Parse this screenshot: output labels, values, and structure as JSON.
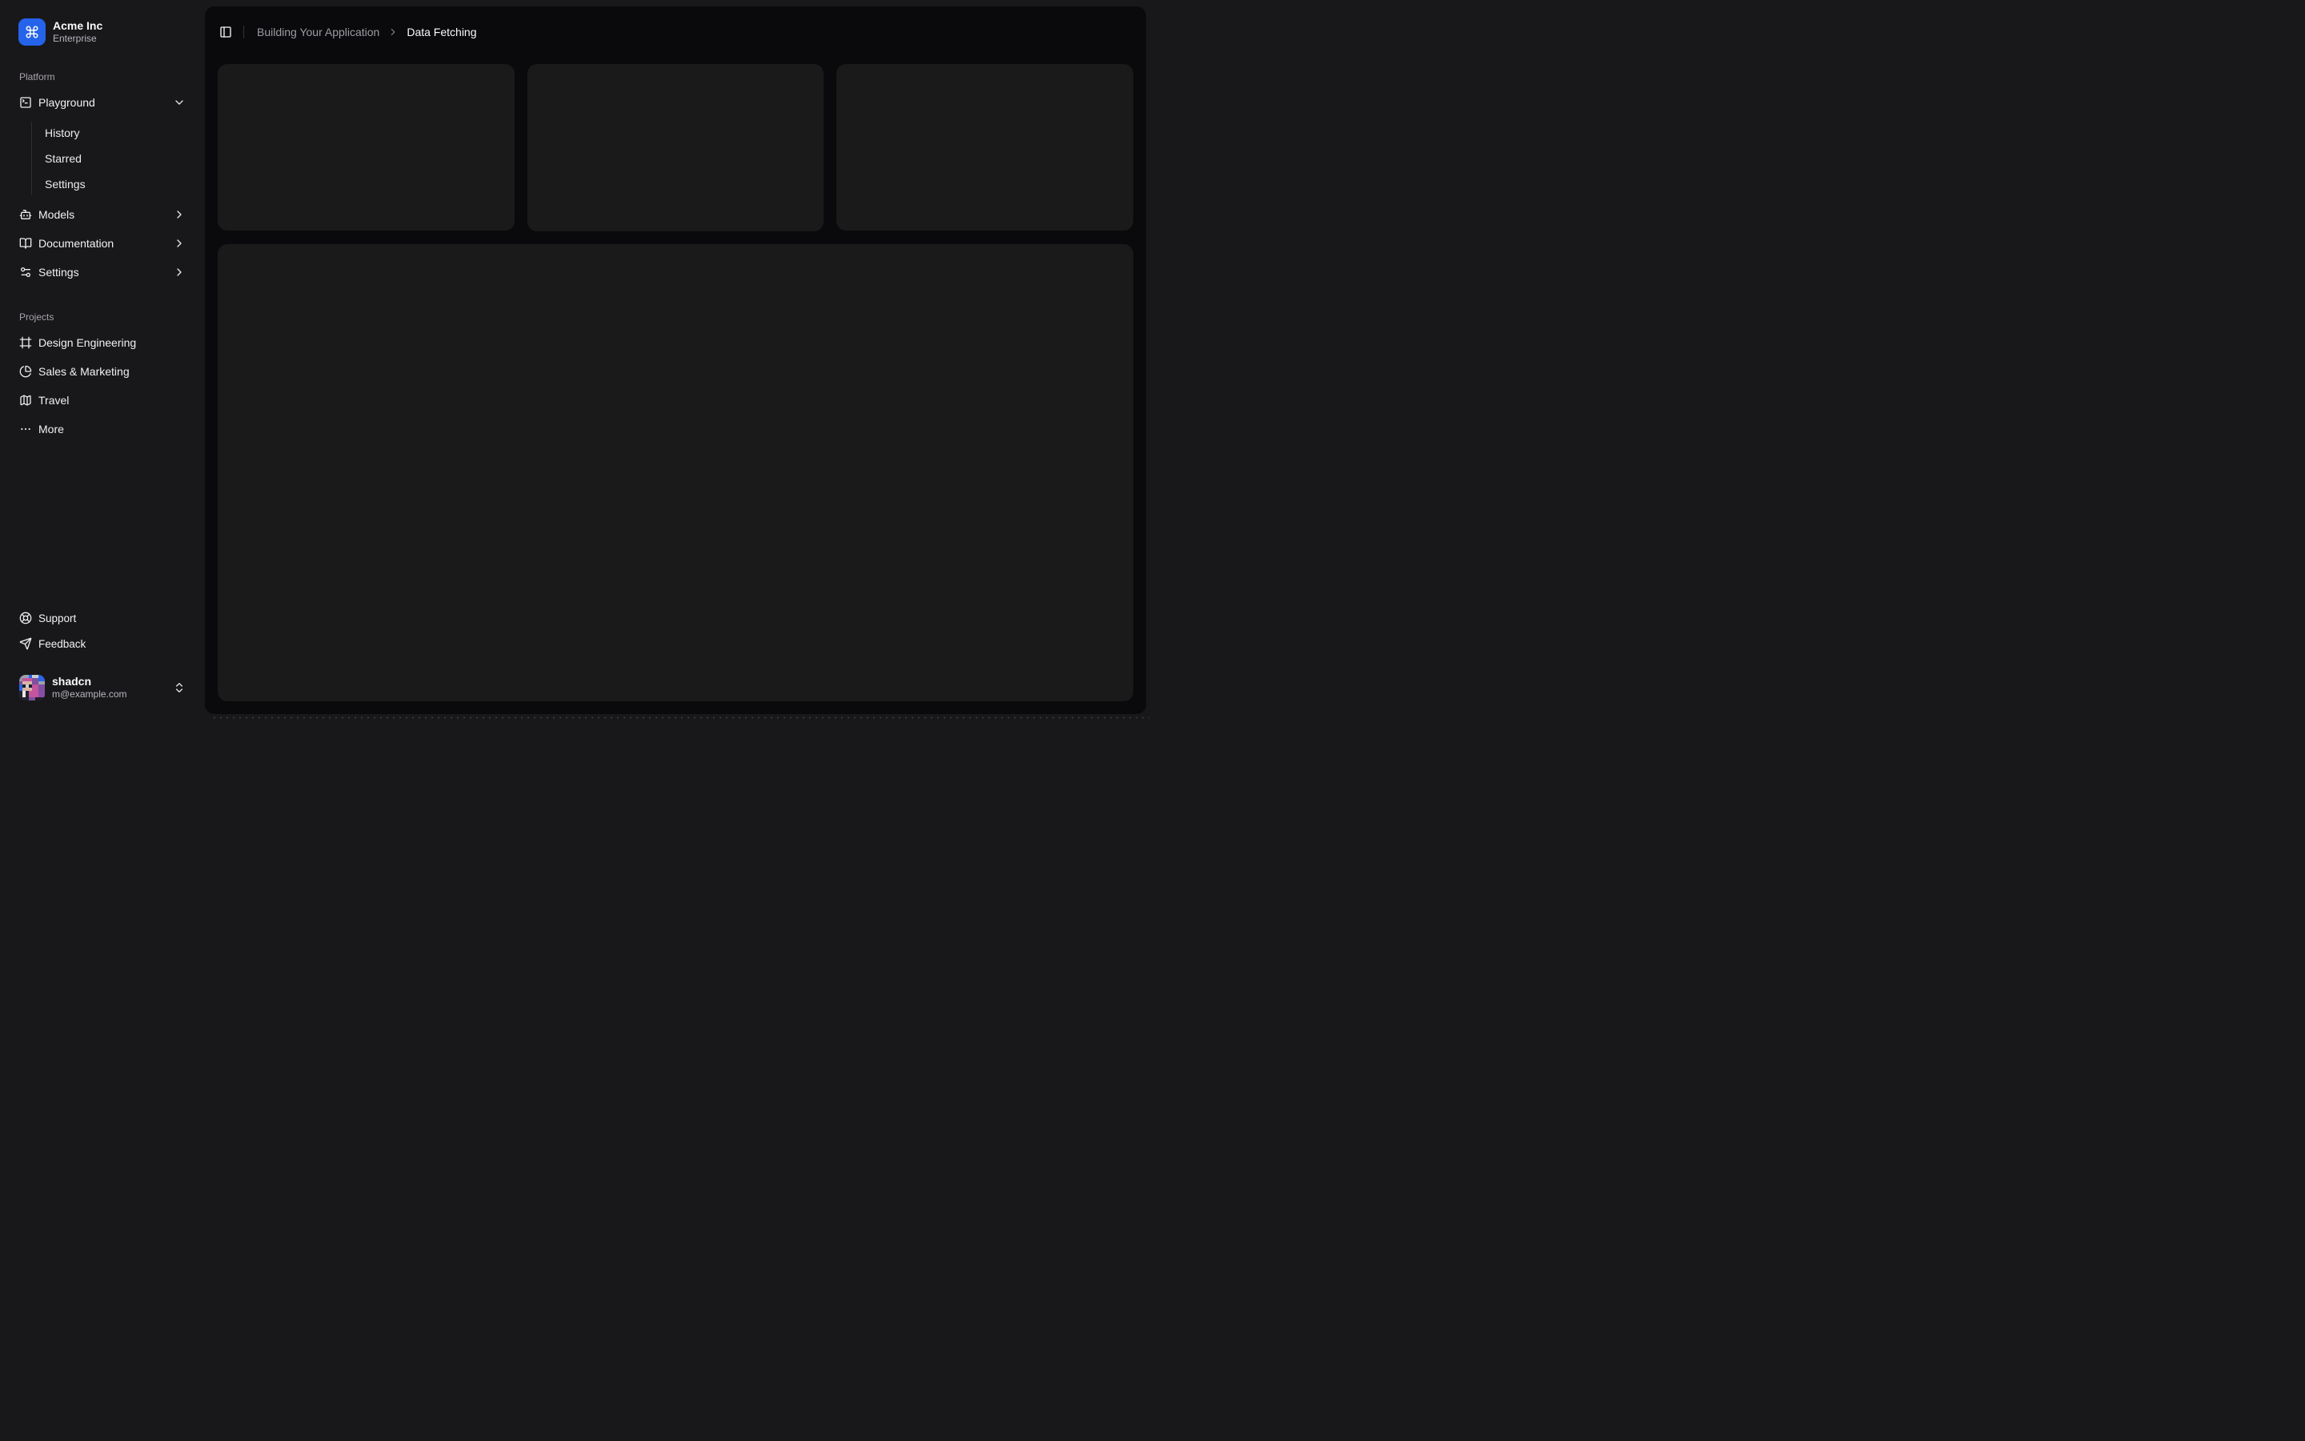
{
  "colors": {
    "accent": "#2563eb",
    "sidebar_bg": "#18181b",
    "main_bg": "#0a0a0c",
    "card_bg": "#1a1a1a"
  },
  "team": {
    "name": "Acme Inc",
    "plan": "Enterprise"
  },
  "nav": {
    "platform_label": "Platform",
    "playground_label": "Playground",
    "playground_children": [
      "History",
      "Starred",
      "Settings"
    ],
    "models_label": "Models",
    "documentation_label": "Documentation",
    "settings_label": "Settings",
    "projects_label": "Projects",
    "projects": [
      "Design Engineering",
      "Sales & Marketing",
      "Travel",
      "More"
    ],
    "support_label": "Support",
    "feedback_label": "Feedback"
  },
  "user": {
    "name": "shadcn",
    "email": "m@example.com"
  },
  "header": {
    "breadcrumb_parent": "Building Your Application",
    "breadcrumb_current": "Data Fetching"
  }
}
